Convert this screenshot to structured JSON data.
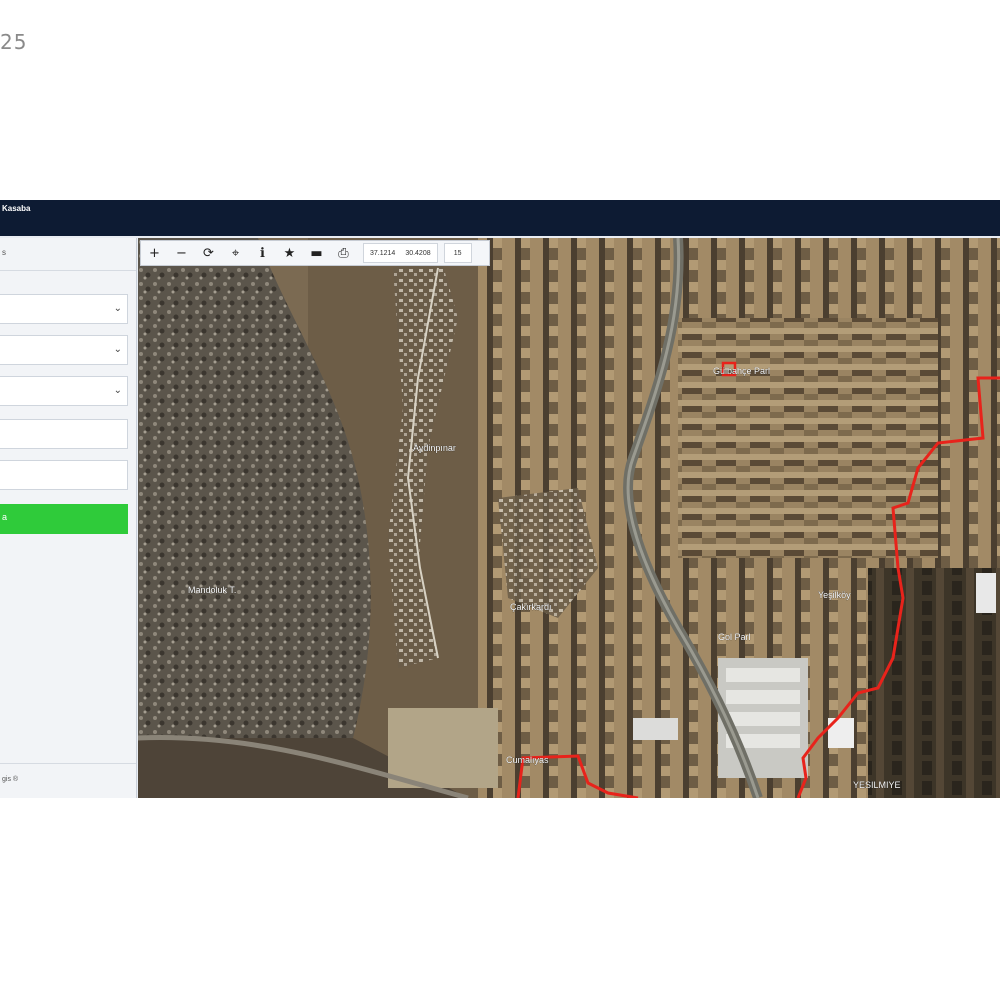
{
  "page": {
    "corner_number": "25"
  },
  "app": {
    "title": "Kasaba"
  },
  "sidebar": {
    "header": "s",
    "selects": [
      {
        "value": ""
      },
      {
        "value": ""
      },
      {
        "value": ""
      }
    ],
    "inputs": [
      {
        "value": ""
      },
      {
        "value": ""
      }
    ],
    "submit_label": "a",
    "footer": "gis ®"
  },
  "toolbar": {
    "icons": [
      "zoom-in-icon",
      "zoom-out-icon",
      "refresh-icon",
      "locate-icon",
      "info-icon",
      "star-icon",
      "minus-icon",
      "print-icon"
    ],
    "glyphs": [
      "+",
      "−",
      "⟳",
      "⌖",
      "ℹ",
      "★",
      "▬",
      "⎙"
    ],
    "coord_x": "37.1214",
    "coord_y": "30.4208",
    "zoom": "15"
  },
  "map": {
    "labels": {
      "l1": "Gülbahçe Parl",
      "l2": "Aydinpınar",
      "l3": "Mandoluk T.",
      "l4": "Gol Parl",
      "l5": "Yeşilköy",
      "l6": "Çakırkardı",
      "l7": "Cumalıyas",
      "l8": "YESILMIYE"
    },
    "colors": {
      "boundary": "#e8231b",
      "road": "#6f6f66"
    }
  }
}
